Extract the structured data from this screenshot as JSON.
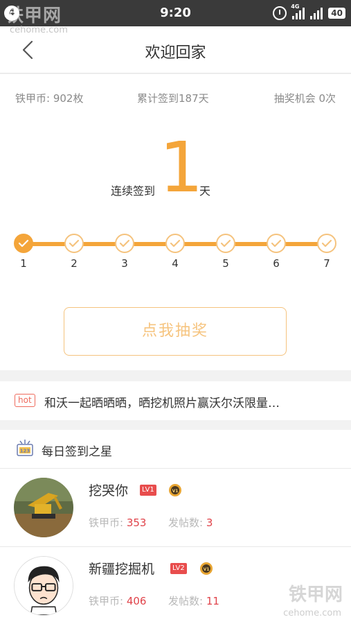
{
  "status_bar": {
    "left_badge": "4",
    "time": "9:20",
    "network": "4G",
    "battery": "40"
  },
  "watermark": {
    "brand": "铁甲网",
    "domain": "cehome.com"
  },
  "header": {
    "title": "欢迎回家"
  },
  "stats": {
    "coins": "铁甲币: 902枚",
    "total_checkin": "累计签到187天",
    "lottery_chances": "抽奖机会 0次"
  },
  "streak": {
    "label": "连续签到",
    "days": "1",
    "unit": "天"
  },
  "progress": {
    "days": [
      "1",
      "2",
      "3",
      "4",
      "5",
      "6",
      "7"
    ],
    "completed": 1,
    "accent_color": "#f4a53a"
  },
  "lottery_button": {
    "label": "点我抽奖"
  },
  "hot_banner": {
    "badge": "hot",
    "text": "和沃一起晒晒晒，晒挖机照片赢沃尔沃限量…"
  },
  "daily_stars": {
    "title": "每日签到之星",
    "users": [
      {
        "name": "挖哭你",
        "level": "LV1",
        "coins_label": "铁甲币:",
        "coins": "353",
        "posts_label": "发帖数:",
        "posts": "3"
      },
      {
        "name": "新疆挖掘机",
        "level": "LV2",
        "coins_label": "铁甲币:",
        "coins": "406",
        "posts_label": "发帖数:",
        "posts": "11"
      }
    ]
  }
}
